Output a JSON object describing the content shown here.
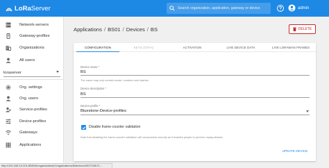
{
  "header": {
    "logo_part1": "LoRa",
    "logo_part2": "Server",
    "search_placeholder": "Search organization, application, gateway or device",
    "user": "admin"
  },
  "sidebar": {
    "top_items": [
      {
        "label": "Network-servers",
        "icon": "server-icon"
      },
      {
        "label": "Gateway-profiles",
        "icon": "gateway-icon"
      },
      {
        "label": "Organizations",
        "icon": "domain-icon"
      },
      {
        "label": "All users",
        "icon": "account-icon"
      }
    ],
    "org_select": "loraserver",
    "org_items": [
      {
        "label": "Org. settings",
        "icon": "gear-icon"
      },
      {
        "label": "Org. users",
        "icon": "account-icon"
      },
      {
        "label": "Service-profiles",
        "icon": "account-key-icon"
      },
      {
        "label": "Device-profiles",
        "icon": "tune-icon"
      },
      {
        "label": "Gateways",
        "icon": "wifi-icon"
      },
      {
        "label": "Applications",
        "icon": "apps-icon"
      }
    ]
  },
  "breadcrumb": {
    "items": [
      "Applications",
      "BS01",
      "Devices",
      "BS"
    ],
    "separator": "/"
  },
  "delete_label": "DELETE",
  "tabs": [
    {
      "label": "CONFIGURATION",
      "state": "active"
    },
    {
      "label": "KEYS (OTAA)",
      "state": "disabled"
    },
    {
      "label": "ACTIVATION",
      "state": "normal"
    },
    {
      "label": "LIVE DEVICE DATA",
      "state": "normal"
    },
    {
      "label": "LIVE LORAWAN FRAMES",
      "state": "normal"
    }
  ],
  "form": {
    "name_label": "Device name *",
    "name_value": "BS",
    "name_help": "The name may only contain words, numbers and dashes.",
    "desc_label": "Device description *",
    "desc_value": "BS",
    "profile_label": "Device-profile *",
    "profile_value": "Bluestone-Device-profiles",
    "checkbox_label": "Disable frame-counter validation",
    "checkbox_checked": true,
    "note": "Note that disabling the frame-counter validation will compromise security as it enables people to perform replay-attacks.",
    "submit_label": "UPDATE DEVICE"
  },
  "status_url": "http://192.168.10.201:8080/#/organizations/1/applications/8/devices/00271f4b71...",
  "colors": {
    "primary": "#1e88e5",
    "danger": "#c62828"
  }
}
